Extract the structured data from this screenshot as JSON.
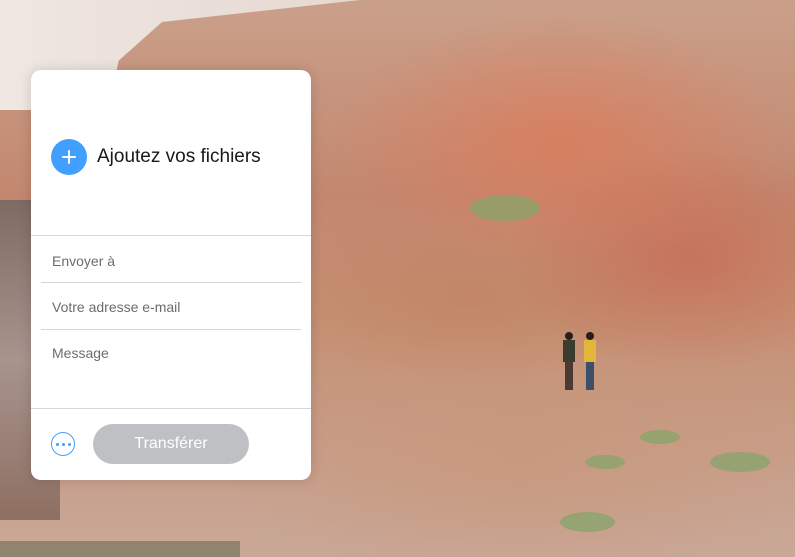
{
  "upload": {
    "label": "Ajoutez vos fichiers"
  },
  "form": {
    "recipient_placeholder": "Envoyer à",
    "sender_placeholder": "Votre adresse e-mail",
    "message_placeholder": "Message"
  },
  "actions": {
    "transfer_label": "Transférer"
  },
  "colors": {
    "accent": "#409fff",
    "button_disabled": "#bfc0c3"
  }
}
